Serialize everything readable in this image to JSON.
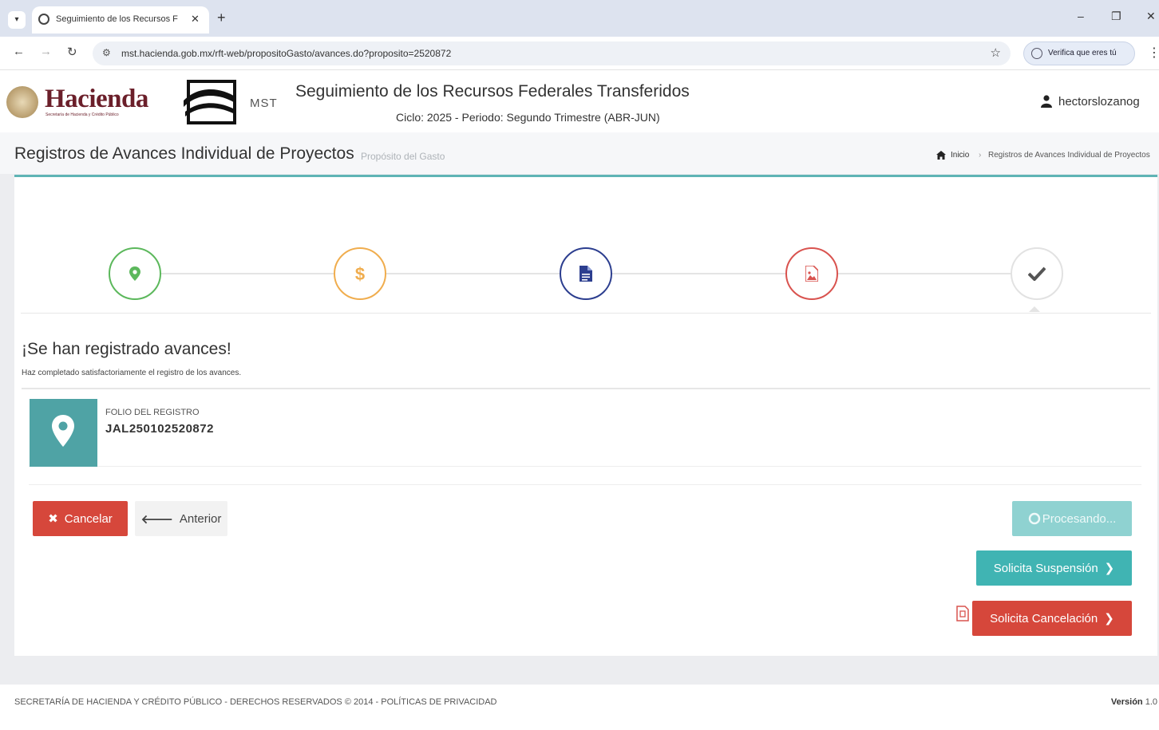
{
  "browser": {
    "tab_title": "Seguimiento de los Recursos F",
    "url": "mst.hacienda.gob.mx/rft-web/propositoGasto/avances.do?proposito=2520872",
    "verify_label": "Verifica que eres tú"
  },
  "header": {
    "brand": "Hacienda",
    "brand_subtitle": "Secretaría de Hacienda y Crédito Público",
    "mst_label": "MST",
    "title": "Seguimiento de los Recursos Federales Transferidos",
    "cycle": "Ciclo: 2025 - Periodo: Segundo Trimestre (ABR-JUN)",
    "user": "hectorslozanog"
  },
  "page": {
    "title": "Registros de Avances Individual de Proyectos",
    "subtitle": "Propósito del Gasto",
    "breadcrumb_home": "Inicio",
    "breadcrumb_current": "Registros de Avances Individual de Proyectos"
  },
  "wizard": {
    "steps": [
      {
        "icon": "map-marker-icon",
        "color": "#5cb85c"
      },
      {
        "icon": "dollar-icon",
        "color": "#f0ad4e",
        "glyph": "$"
      },
      {
        "icon": "document-icon",
        "color": "#2c3e8f"
      },
      {
        "icon": "image-file-icon",
        "color": "#d9534f"
      },
      {
        "icon": "check-icon",
        "color": "#555555",
        "active": true
      }
    ]
  },
  "result": {
    "title": "¡Se han registrado avances!",
    "description": "Haz completado satisfactoriamente el registro de los avances.",
    "folio_label": "FOLIO DEL REGISTRO",
    "folio_value": "JAL250102520872"
  },
  "actions": {
    "cancel": "Cancelar",
    "previous": "Anterior",
    "processing": "Procesando...",
    "request_suspension": "Solicita Suspensión",
    "request_cancellation": "Solicita Cancelación"
  },
  "footer": {
    "text": "SECRETARÍA DE HACIENDA Y CRÉDITO PÚBLICO - DERECHOS RESERVADOS © 2014 - POLÍTICAS DE PRIVACIDAD",
    "version_label": "Versión",
    "version_value": "1.0"
  },
  "colors": {
    "teal": "#4fa3a5",
    "red": "#d6473b",
    "brand": "#6b1f2a"
  }
}
